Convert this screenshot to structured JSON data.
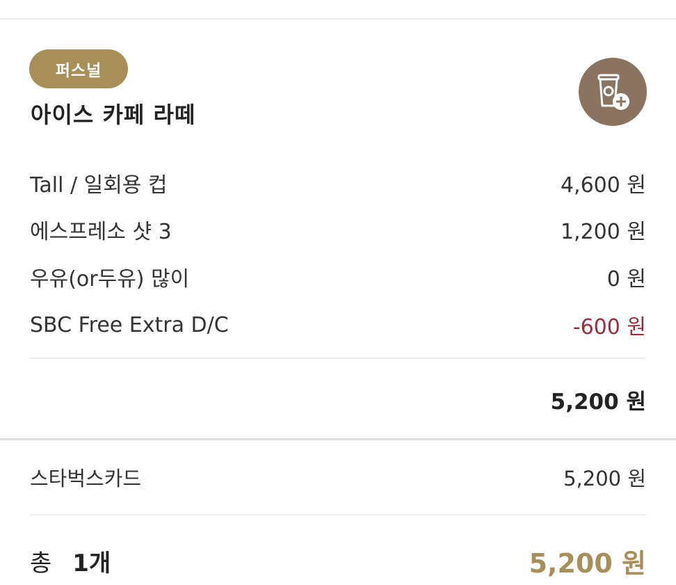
{
  "item": {
    "badge": "퍼스널",
    "name": "아이스 카페 라떼"
  },
  "add_button": {
    "icon": "cup-plus-icon"
  },
  "options": [
    {
      "label": "Tall / 일회용 컵",
      "price": "4,600 원"
    },
    {
      "label": "에스프레소 샷 3",
      "price": "1,200 원"
    },
    {
      "label": "우유(or두유) 많이",
      "price": "0 원"
    },
    {
      "label": "SBC Free Extra D/C",
      "price": "-600 원"
    }
  ],
  "subtotal": "5,200 원",
  "payment": {
    "method": "스타벅스카드",
    "amount": "5,200 원"
  },
  "total": {
    "label": "총",
    "count": "1개",
    "amount": "5,200 원"
  },
  "colors": {
    "badge": "#a88f5a",
    "icon_circle": "#8a7360",
    "negative": "#9c2b3b",
    "total_accent": "#a88f5a"
  }
}
